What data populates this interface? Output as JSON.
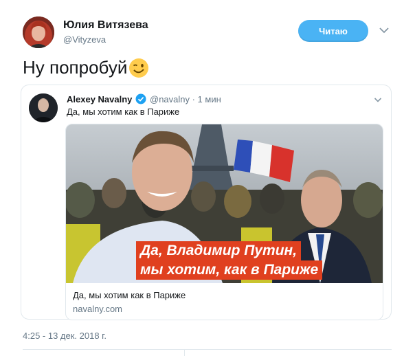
{
  "author": {
    "name": "Юлия Витязева",
    "handle": "@Vityzeva",
    "avatar_icon": "user-avatar"
  },
  "follow_button": {
    "label": "Читаю"
  },
  "tweet": {
    "text": "Ну попробуй",
    "emoji_icon": "winking-face-emoji"
  },
  "quoted_tweet": {
    "author_name": "Alexey Navalny",
    "verified_icon": "verified-badge-icon",
    "handle_time": "@navalny · 1 мин",
    "text": "Да, мы хотим как в Париже",
    "card": {
      "image_overlay_line1": "Да, Владимир Путин,",
      "image_overlay_line2": "мы хотим, как в Париже",
      "title": "Да, мы хотим как в Париже",
      "domain": "navalny.com"
    }
  },
  "timestamp": "4:25 - 13 дек. 2018 г.",
  "colors": {
    "button": "#4ab3f4",
    "secondary_text": "#657786",
    "border": "#e1e8ed",
    "overlay": "#e0401f"
  }
}
